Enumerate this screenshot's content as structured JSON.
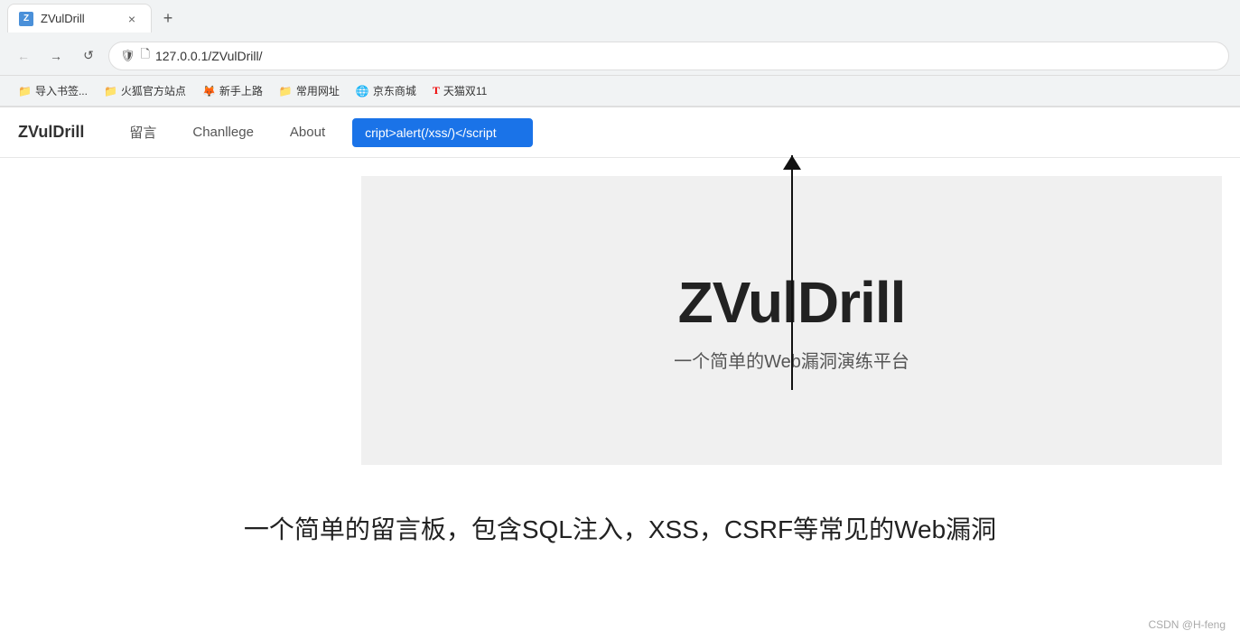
{
  "browser": {
    "tab_title": "ZVulDrill",
    "tab_favicon_text": "Z",
    "close_icon": "×",
    "new_tab_icon": "+",
    "back_icon": "←",
    "forward_icon": "→",
    "refresh_icon": "↺",
    "address_url": "127.0.0.1/ZVulDrill/",
    "shield_icon": "🛡",
    "file_icon": "🗋"
  },
  "bookmarks": [
    {
      "id": "bm1",
      "icon": "📁",
      "label": "导入书签..."
    },
    {
      "id": "bm2",
      "icon": "📁",
      "label": "火狐官方站点"
    },
    {
      "id": "bm3",
      "icon": "🦊",
      "label": "新手上路"
    },
    {
      "id": "bm4",
      "icon": "📁",
      "label": "常用网址"
    },
    {
      "id": "bm5",
      "icon": "🌐",
      "label": "京东商城"
    },
    {
      "id": "bm6",
      "icon": "🅣",
      "label": "天猫双11"
    }
  ],
  "site": {
    "brand": "ZVulDrill",
    "nav_links": [
      {
        "id": "nav-liuyan",
        "label": "留言"
      },
      {
        "id": "nav-challenge",
        "label": "Chanllege"
      },
      {
        "id": "nav-about",
        "label": "About"
      }
    ],
    "xss_input_value": "cript>alert(/xss/)</script",
    "hero_title": "ZVulDrill",
    "hero_subtitle": "一个简单的Web漏洞演练平台",
    "main_description": "一个简单的留言板，包含SQL注入，XSS，CSRF等常见的Web漏洞",
    "footer_credit": "CSDN @H-feng"
  }
}
